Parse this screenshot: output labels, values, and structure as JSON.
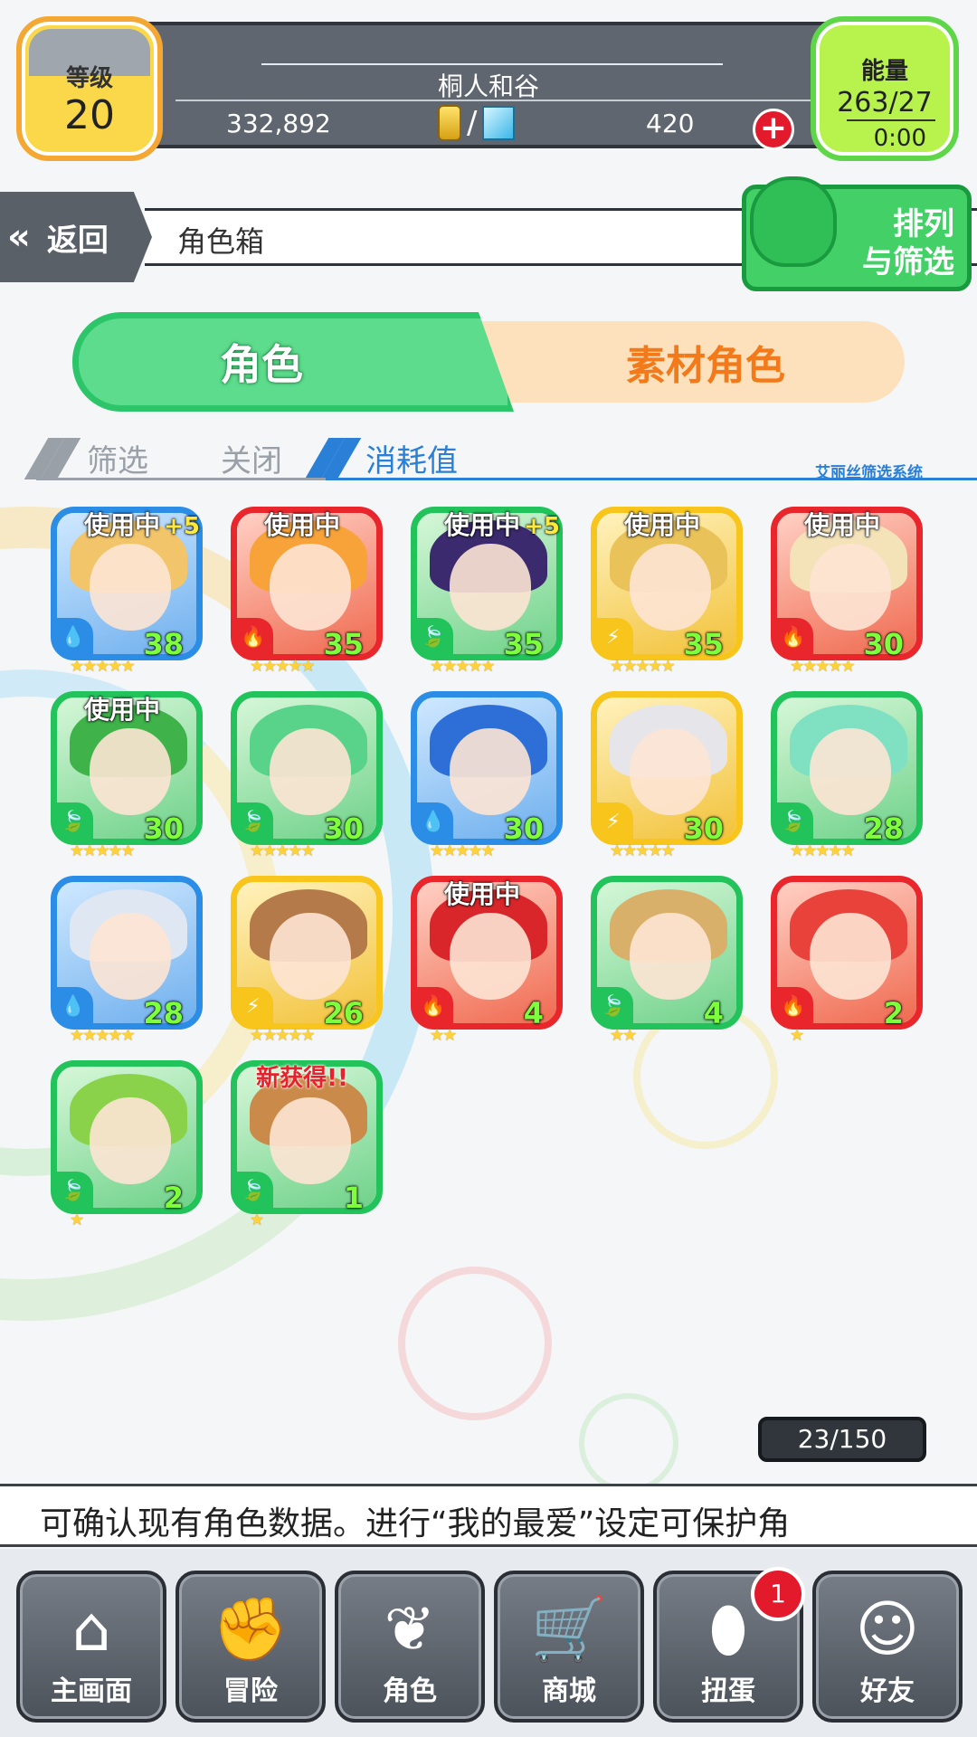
{
  "player": {
    "name": "桐人和谷",
    "level_label": "等级",
    "level": "20",
    "coins": "332,892",
    "gems": "420",
    "energy_label": "能量",
    "energy": "263/27",
    "energy_timer": "0:00"
  },
  "nav_top": {
    "back_label": "返回",
    "page_title": "角色箱",
    "sort_label_1": "排列",
    "sort_label_2": "与筛选"
  },
  "tabs": {
    "characters": "角色",
    "materials": "素材角色"
  },
  "filter": {
    "filter_label": "筛选",
    "close_label": "关闭",
    "cost_label": "消耗值",
    "system_label": "艾丽丝筛选系统"
  },
  "cards": [
    {
      "element": "water",
      "elem_icon": "💧",
      "badge": "使用中",
      "plus": "+5",
      "level": "38",
      "stars": "★★★★★",
      "colors": {
        "hair": "#f2c56a"
      }
    },
    {
      "element": "fire",
      "elem_icon": "🔥",
      "badge": "使用中",
      "plus": "",
      "level": "35",
      "stars": "★★★★★",
      "colors": {
        "hair": "#f7a33a"
      }
    },
    {
      "element": "wind",
      "elem_icon": "🍃",
      "badge": "使用中",
      "plus": "+5",
      "level": "35",
      "stars": "★★★★★",
      "colors": {
        "hair": "#3b2a6e"
      }
    },
    {
      "element": "thunder",
      "elem_icon": "⚡",
      "badge": "使用中",
      "plus": "",
      "level": "35",
      "stars": "★★★★★",
      "colors": {
        "hair": "#e9c25a"
      }
    },
    {
      "element": "fire",
      "elem_icon": "🔥",
      "badge": "使用中",
      "plus": "",
      "level": "30",
      "stars": "★★★★★",
      "colors": {
        "hair": "#f4e2b8"
      }
    },
    {
      "element": "wind",
      "elem_icon": "🍃",
      "badge": "使用中",
      "plus": "",
      "level": "30",
      "stars": "★★★★★",
      "colors": {
        "hair": "#3fb24a"
      }
    },
    {
      "element": "wind",
      "elem_icon": "🍃",
      "badge": "",
      "plus": "",
      "level": "30",
      "stars": "★★★★★",
      "colors": {
        "hair": "#59d28a"
      }
    },
    {
      "element": "water",
      "elem_icon": "💧",
      "badge": "",
      "plus": "",
      "level": "30",
      "stars": "★★★★★",
      "colors": {
        "hair": "#2d6fd6"
      }
    },
    {
      "element": "thunder",
      "elem_icon": "⚡",
      "badge": "",
      "plus": "",
      "level": "30",
      "stars": "★★★★★",
      "colors": {
        "hair": "#e6e6ea"
      }
    },
    {
      "element": "wind",
      "elem_icon": "🍃",
      "badge": "",
      "plus": "",
      "level": "28",
      "stars": "★★★★★",
      "colors": {
        "hair": "#7fe0c2"
      }
    },
    {
      "element": "water",
      "elem_icon": "💧",
      "badge": "",
      "plus": "",
      "level": "28",
      "stars": "★★★★★",
      "colors": {
        "hair": "#dfe7f2"
      }
    },
    {
      "element": "thunder",
      "elem_icon": "⚡",
      "badge": "",
      "plus": "",
      "level": "26",
      "stars": "★★★★★",
      "colors": {
        "hair": "#b57a4a"
      }
    },
    {
      "element": "fire",
      "elem_icon": "🔥",
      "badge": "使用中",
      "plus": "",
      "level": "4",
      "stars": "★★",
      "colors": {
        "hair": "#d8262a"
      }
    },
    {
      "element": "wind",
      "elem_icon": "🍃",
      "badge": "",
      "plus": "",
      "level": "4",
      "stars": "★★",
      "colors": {
        "hair": "#d9b06a"
      }
    },
    {
      "element": "fire",
      "elem_icon": "🔥",
      "badge": "",
      "plus": "",
      "level": "2",
      "stars": "★",
      "colors": {
        "hair": "#e8423a"
      }
    },
    {
      "element": "wind",
      "elem_icon": "🍃",
      "badge": "",
      "plus": "",
      "level": "2",
      "stars": "★",
      "colors": {
        "hair": "#8ad24a"
      }
    },
    {
      "element": "wind",
      "elem_icon": "🍃",
      "badge": "新获得!!",
      "plus": "",
      "level": "1",
      "stars": "★",
      "colors": {
        "hair": "#c98a4a"
      }
    }
  ],
  "capacity": "23/150",
  "ticker": "可确认现有角色数据。进行“我的最爱”设定可保护角",
  "bottom_nav": {
    "home": "主画面",
    "adventure": "冒险",
    "characters": "角色",
    "shop": "商城",
    "gacha": "扭蛋",
    "friends": "好友",
    "gacha_badge": "1"
  },
  "colors": {
    "accent_green": "#42d067",
    "accent_orange": "#f27a1a",
    "filter_blue": "#2a7fd6"
  }
}
